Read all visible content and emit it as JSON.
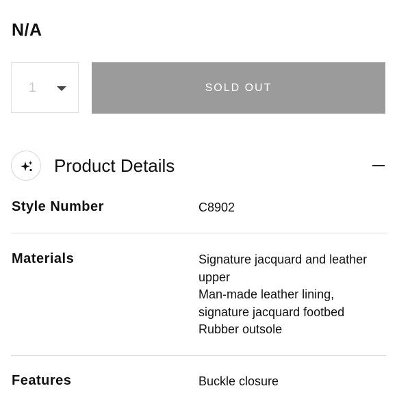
{
  "product": {
    "price": "N/A"
  },
  "purchase": {
    "quantity": "1",
    "sold_out_label": "SOLD OUT"
  },
  "details": {
    "title": "Product Details",
    "icon": "sparkle-icon",
    "collapse_icon": "collapse-icon",
    "rows": [
      {
        "label": "Style Number",
        "values": [
          "C8902"
        ]
      },
      {
        "label": "Materials",
        "values": [
          "Signature jacquard and leather",
          "upper",
          "Man-made leather lining,",
          "signature jacquard footbed",
          "Rubber outsole"
        ]
      },
      {
        "label": "Features",
        "values": [
          "Buckle closure"
        ]
      }
    ]
  },
  "colors": {
    "sold_out_bg": "#9b9b9b",
    "divider": "#d9d9d9"
  }
}
